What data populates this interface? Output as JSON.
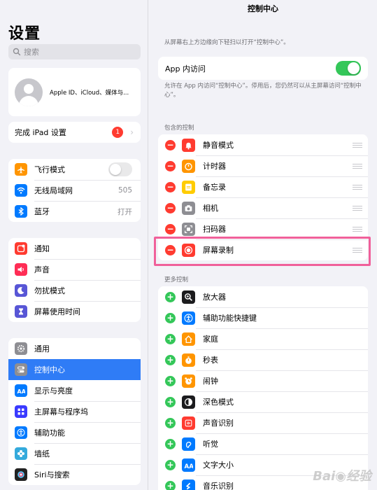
{
  "sidebar": {
    "title": "设置",
    "search_placeholder": "搜索",
    "profile_subtitle": "Apple ID、iCloud、媒体与...",
    "setup": {
      "label": "完成 iPad 设置",
      "badge": "1"
    },
    "network_group": [
      {
        "label": "飞行模式",
        "icon": "airplane-icon",
        "color": "#ff9500",
        "toggle": "off"
      },
      {
        "label": "无线局域网",
        "icon": "wifi-icon",
        "color": "#007aff",
        "value": "505"
      },
      {
        "label": "蓝牙",
        "icon": "bluetooth-icon",
        "color": "#007aff",
        "value": "打开"
      }
    ],
    "notify_group": [
      {
        "label": "通知",
        "icon": "notification-icon",
        "color": "#ff3b30"
      },
      {
        "label": "声音",
        "icon": "speaker-icon",
        "color": "#ff2d55"
      },
      {
        "label": "勿扰模式",
        "icon": "moon-icon",
        "color": "#5856d6"
      },
      {
        "label": "屏幕使用时间",
        "icon": "hourglass-icon",
        "color": "#5856d6"
      }
    ],
    "general_group": [
      {
        "label": "通用",
        "icon": "gear-icon",
        "color": "#8e8e93"
      },
      {
        "label": "控制中心",
        "icon": "switches-icon",
        "color": "#8e8e93",
        "active": true
      },
      {
        "label": "显示与亮度",
        "icon": "text-size-icon",
        "color": "#007aff"
      },
      {
        "label": "主屏幕与程序坞",
        "icon": "home-grid-icon",
        "color": "#3a3aff"
      },
      {
        "label": "辅助功能",
        "icon": "accessibility-icon",
        "color": "#007aff"
      },
      {
        "label": "墙纸",
        "icon": "flower-icon",
        "color": "#34aadc"
      },
      {
        "label": "Siri与搜索",
        "icon": "siri-icon",
        "color": "#222222"
      }
    ]
  },
  "main": {
    "title": "控制中心",
    "description_top": "从屏幕右上方边缘向下轻扫以打开“控制中心”。",
    "app_access": {
      "label": "App 内访问",
      "toggle": "on"
    },
    "description_app": "允许在 App 内访问“控制中心”。停用后，您仍然可以从主屏幕访问“控制中心”。",
    "included_header": "包含的控制",
    "included": [
      {
        "label": "静音模式",
        "icon": "bell-icon",
        "color": "#ff3b30"
      },
      {
        "label": "计时器",
        "icon": "timer-icon",
        "color": "#ff9500"
      },
      {
        "label": "备忘录",
        "icon": "notes-icon",
        "color": "#ffcc00"
      },
      {
        "label": "相机",
        "icon": "camera-icon",
        "color": "#8e8e93"
      },
      {
        "label": "扫码器",
        "icon": "qr-scanner-icon",
        "color": "#8e8e93"
      },
      {
        "label": "屏幕录制",
        "icon": "record-icon",
        "color": "#ff3b30"
      }
    ],
    "more_header": "更多控制",
    "more": [
      {
        "label": "放大器",
        "icon": "magnifier-icon",
        "color": "#1c1c1e"
      },
      {
        "label": "辅助功能快捷键",
        "icon": "accessibility-icon",
        "color": "#007aff"
      },
      {
        "label": "家庭",
        "icon": "home-icon",
        "color": "#ff9500"
      },
      {
        "label": "秒表",
        "icon": "stopwatch-icon",
        "color": "#ff9500"
      },
      {
        "label": "闹钟",
        "icon": "alarm-icon",
        "color": "#ff9500"
      },
      {
        "label": "深色模式",
        "icon": "dark-mode-icon",
        "color": "#1c1c1e"
      },
      {
        "label": "声音识别",
        "icon": "sound-recognition-icon",
        "color": "#ff3b30"
      },
      {
        "label": "听觉",
        "icon": "ear-icon",
        "color": "#007aff"
      },
      {
        "label": "文字大小",
        "icon": "text-size-icon",
        "color": "#007aff"
      },
      {
        "label": "音乐识别",
        "icon": "shazam-icon",
        "color": "#007aff"
      }
    ]
  }
}
